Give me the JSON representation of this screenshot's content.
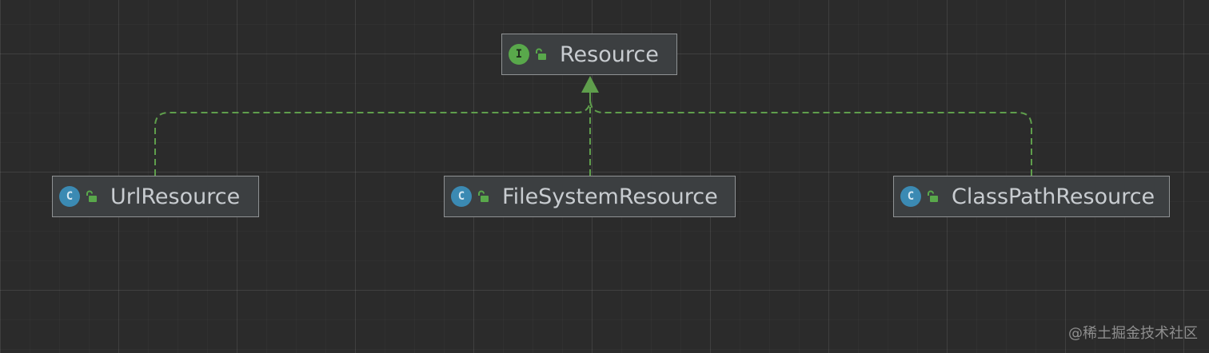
{
  "diagram": {
    "nodes": [
      {
        "id": "resource",
        "kind": "interface",
        "kind_letter": "I",
        "name": "Resource",
        "visibility_icon": "unlock-icon"
      },
      {
        "id": "url",
        "kind": "class",
        "kind_letter": "C",
        "name": "UrlResource",
        "visibility_icon": "unlock-icon"
      },
      {
        "id": "filesystem",
        "kind": "class",
        "kind_letter": "C",
        "name": "FileSystemResource",
        "visibility_icon": "unlock-icon"
      },
      {
        "id": "classpath",
        "kind": "class",
        "kind_letter": "C",
        "name": "ClassPathResource",
        "visibility_icon": "unlock-icon"
      }
    ],
    "edges": [
      {
        "from": "url",
        "to": "resource",
        "type": "implements",
        "style": "dashed"
      },
      {
        "from": "filesystem",
        "to": "resource",
        "type": "implements",
        "style": "dashed"
      },
      {
        "from": "classpath",
        "to": "resource",
        "type": "implements",
        "style": "dashed"
      }
    ],
    "colors": {
      "background": "#2b2b2b",
      "node_fill": "#3c3f41",
      "node_border": "#8f9294",
      "edge": "#5f9e4c",
      "interface_badge": "#59a84b",
      "class_badge": "#3b8ab3",
      "text": "#c8ccd0"
    }
  },
  "watermark": "@稀土掘金技术社区"
}
